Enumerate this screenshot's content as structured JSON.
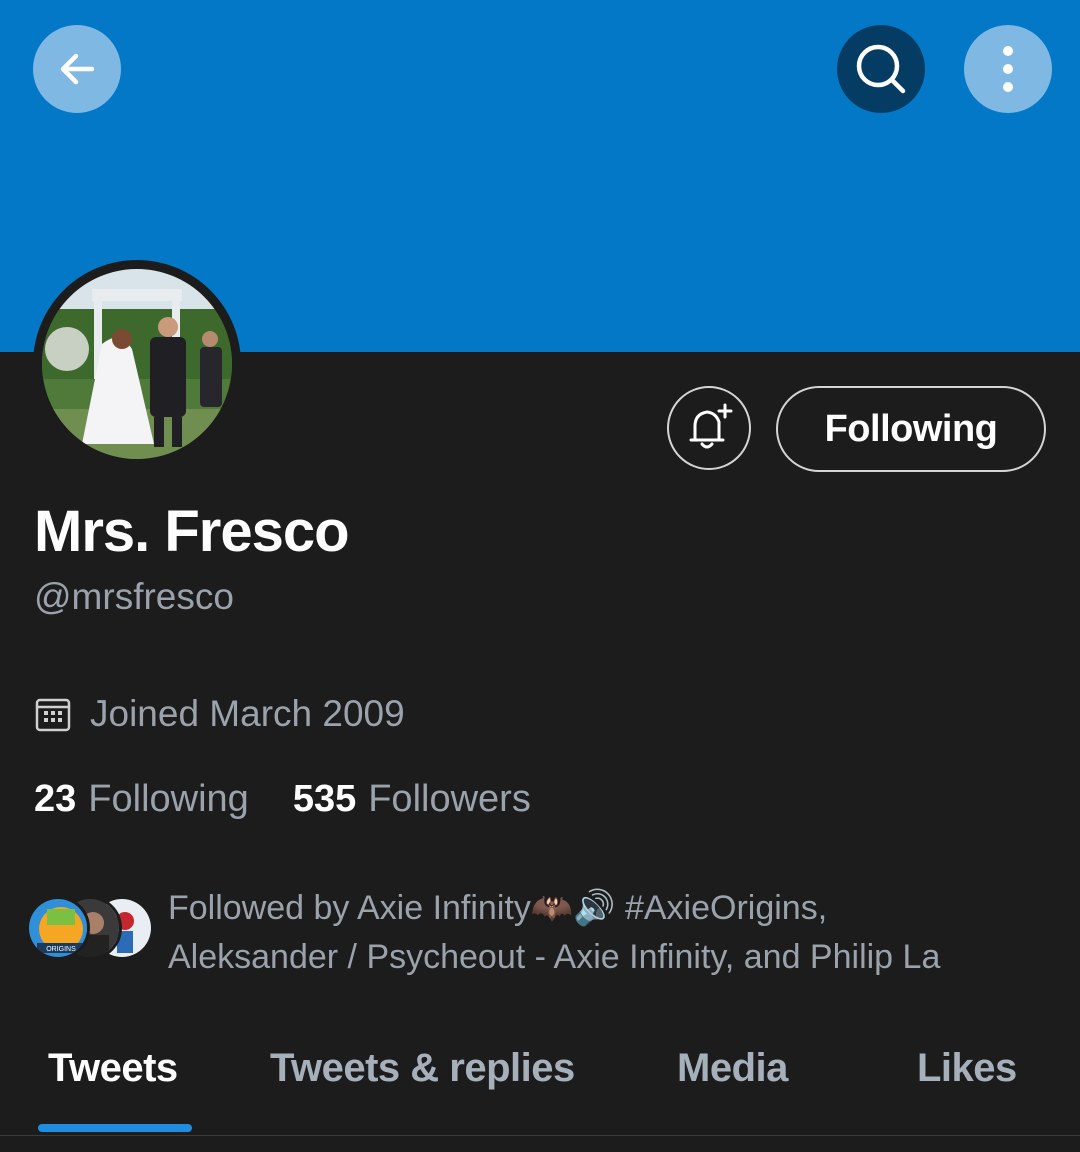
{
  "header": {
    "banner_color": "#0278c6",
    "back_icon": "arrow-left-icon",
    "search_icon": "search-icon",
    "more_icon": "more-vertical-icon"
  },
  "profile": {
    "display_name": "Mrs. Fresco",
    "handle": "@mrsfresco",
    "joined": "Joined March 2009",
    "following_count": "23",
    "following_label": "Following",
    "followers_count": "535",
    "followers_label": "Followers"
  },
  "actions": {
    "notify_icon": "bell-plus-icon",
    "following_button": "Following"
  },
  "followed_by": {
    "line1": "Followed by Axie Infinity🦇🔊 #AxieOrigins,",
    "line2": "Aleksander / Psycheout - Axie Infinity, and Philip La",
    "avatar_badge": "ORIGINS"
  },
  "tabs": [
    {
      "label": "Tweets",
      "active": true
    },
    {
      "label": "Tweets & replies",
      "active": false
    },
    {
      "label": "Media",
      "active": false
    },
    {
      "label": "Likes",
      "active": false
    }
  ],
  "colors": {
    "background": "#1c1c1c",
    "accent": "#1d8ee0",
    "secondary_text": "#9aa2ab"
  }
}
